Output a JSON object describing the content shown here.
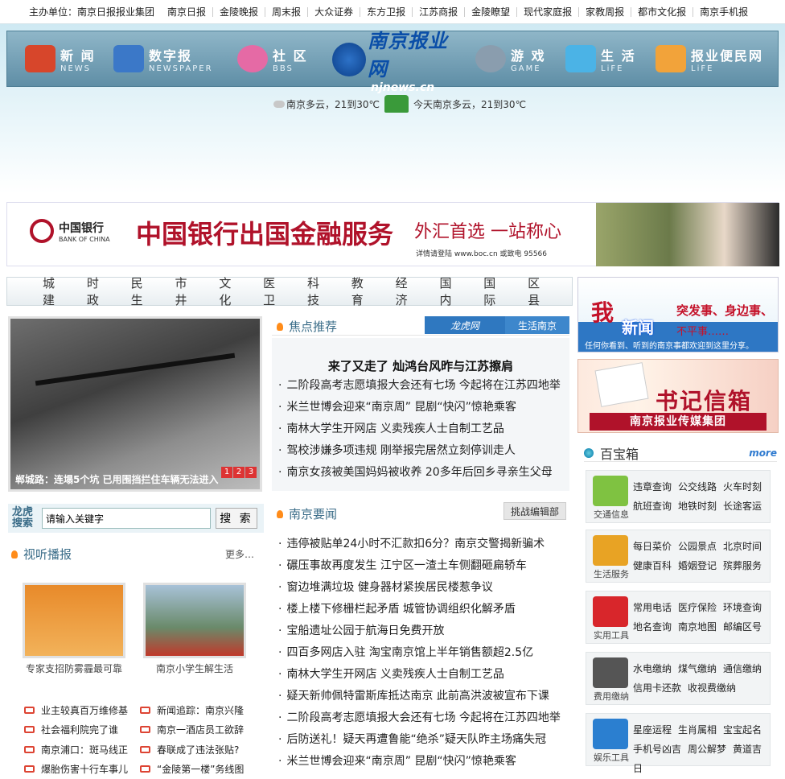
{
  "topbar": {
    "lead": "主办单位：南京日报报业集团",
    "links": [
      "南京日报",
      "金陵晚报",
      "周末报",
      "大众证券",
      "东方卫报",
      "江苏商报",
      "金陵瞭望",
      "现代家庭报",
      "家教周报",
      "都市文化报",
      "南京手机报"
    ]
  },
  "nav": {
    "items": [
      {
        "cn": "新 闻",
        "en": "NEWS",
        "icon": "news-icon",
        "color": "#d7462b"
      },
      {
        "cn": "数字报",
        "en": "NEWSPAPER",
        "icon": "newspaper-icon",
        "color": "#3b78c8"
      },
      {
        "cn": "社 区",
        "en": "BBS",
        "icon": "bbs-icon",
        "color": "#e56aa5"
      },
      {
        "cn": "游 戏",
        "en": "GAME",
        "icon": "game-icon",
        "color": "#8a9dae"
      },
      {
        "cn": "生 活",
        "en": "LiFE",
        "icon": "life-icon",
        "color": "#4bb3e6"
      },
      {
        "cn": "报业便民网",
        "en": "LiFE",
        "icon": "convenience-icon",
        "color": "#f2a33a"
      }
    ],
    "logo_cn": "南京报业网",
    "logo_en": "njnews.cn"
  },
  "weather": {
    "today_short": "南京多云，21到30℃",
    "today_full": "今天南京多云，21到30℃"
  },
  "ad": {
    "bank": "中国银行",
    "bank_en": "BANK OF CHINA",
    "slogan": "中国银行出国金融服务",
    "slogan2": "外汇首选 一站称心",
    "small": "详情请登陆 www.boc.cn 或致电 95566"
  },
  "categories": [
    "城建",
    "时政",
    "民生",
    "市井",
    "文化",
    "医卫",
    "科技",
    "教育",
    "经济",
    "国内",
    "国际",
    "区县"
  ],
  "photo": {
    "caption": "郸城路：连塌5个坑 已用围挡拦住车辆无法进入",
    "pages": [
      "1",
      "2",
      "3"
    ]
  },
  "search": {
    "brand": "龙虎搜索",
    "placeholder": "请输入关键字",
    "button": "搜 索"
  },
  "video": {
    "title": "视听播报",
    "more": "更多…",
    "thumbs": [
      "专家支招防雾霾最可靠",
      "南京小学生解生活"
    ],
    "list_left": [
      "业主较真百万维修基",
      "社会福利院完了谁",
      "南京浦口：斑马线正",
      "爆胎伤害十行车事儿"
    ],
    "list_right": [
      "新闻追踪：南京兴隆",
      "南京一酒店员工欲辞",
      "春联成了违法张贴?",
      "“金陵第一楼”务线图"
    ]
  },
  "focus": {
    "title": "焦点推荐",
    "tab1": "龙虎网",
    "tab2": "生活南京",
    "headline": "来了又走了 灿鸿台风昨与江苏擦肩",
    "items": [
      "二阶段高考志愿填报大会还有七场 今起将在江苏四地举",
      "米兰世博会迎来“南京周” 昆剧“快闪”惊艳乘客",
      "南林大学生开网店 义卖残疾人士自制工艺品",
      "驾校涉嫌多项违规 刚举报完居然立刻停训走人",
      "南京女孩被美国妈妈被收养 20多年后回乡寻亲生父母"
    ]
  },
  "nanjing": {
    "title": "南京要闻",
    "tag": "挑战编辑部",
    "items": [
      "违停被贴单24小时不汇款扣6分？南京交警揭新骗术",
      "碾压事故再度发生 江宁区一渣土车侧翻砸扁轿车",
      "窗边堆满垃圾 健身器材紧挨居民楼惹争议",
      "楼上楼下修栅栏起矛盾 城管协调组织化解矛盾",
      "宝船遗址公园于航海日免费开放",
      "四百多网店入驻 淘宝南京馆上半年销售额超2.5亿",
      "南林大学生开网店 义卖残疾人士自制工艺品",
      "疑天新帅佩特雷斯库抵达南京 此前高洪波被宣布下课",
      "二阶段高考志愿填报大会还有七场 今起将在江苏四地举",
      "后防送礼！疑天再遭鲁能“绝杀”疑天队昨主场痛失冠",
      "米兰世博会迎来“南京周” 昆剧“快闪”惊艳乘客"
    ]
  },
  "right": {
    "ad1_big": "我",
    "ad1_big2": "新闻",
    "ad1_l1": "突发事、身边事、",
    "ad1_l2": "不平事……",
    "ad1_l3": "任何你看到、听到的南京事都欢迎到这里分享。",
    "ad2_title": "书记信箱",
    "ad2_sub": "南京报业传媒集团",
    "bbx_title": "百宝箱",
    "bbx_more": "more",
    "boxes": [
      {
        "cap": "交通信息",
        "icon": "car-icon",
        "color": "#7fc241",
        "l1": [
          "违章查询",
          "公交线路",
          "火车时刻"
        ],
        "l2": [
          "航班查询",
          "地铁时刻",
          "长途客运"
        ]
      },
      {
        "cap": "生活服务",
        "icon": "house-icon",
        "color": "#e8a324",
        "l1": [
          "每日菜价",
          "公园景点",
          "北京时间"
        ],
        "l2": [
          "健康百科",
          "婚姻登记",
          "殡葬服务"
        ]
      },
      {
        "cap": "实用工具",
        "icon": "toolbox-icon",
        "color": "#d8262b",
        "l1": [
          "常用电话",
          "医疗保险",
          "环境查询"
        ],
        "l2": [
          "地名查询",
          "南京地图",
          "邮编区号"
        ]
      },
      {
        "cap": "费用缴纳",
        "icon": "card-icon",
        "color": "#555555",
        "l1": [
          "水电缴纳",
          "煤气缴纳",
          "通信缴纳"
        ],
        "l2": [
          "信用卡还款",
          "收视费缴纳"
        ]
      },
      {
        "cap": "娱乐工具",
        "icon": "tv-icon",
        "color": "#2b7fd0",
        "l1": [
          "星座运程",
          "生肖属相",
          "宝宝起名"
        ],
        "l2": [
          "手机号凶吉",
          "周公解梦",
          "黄道吉日"
        ]
      }
    ]
  }
}
